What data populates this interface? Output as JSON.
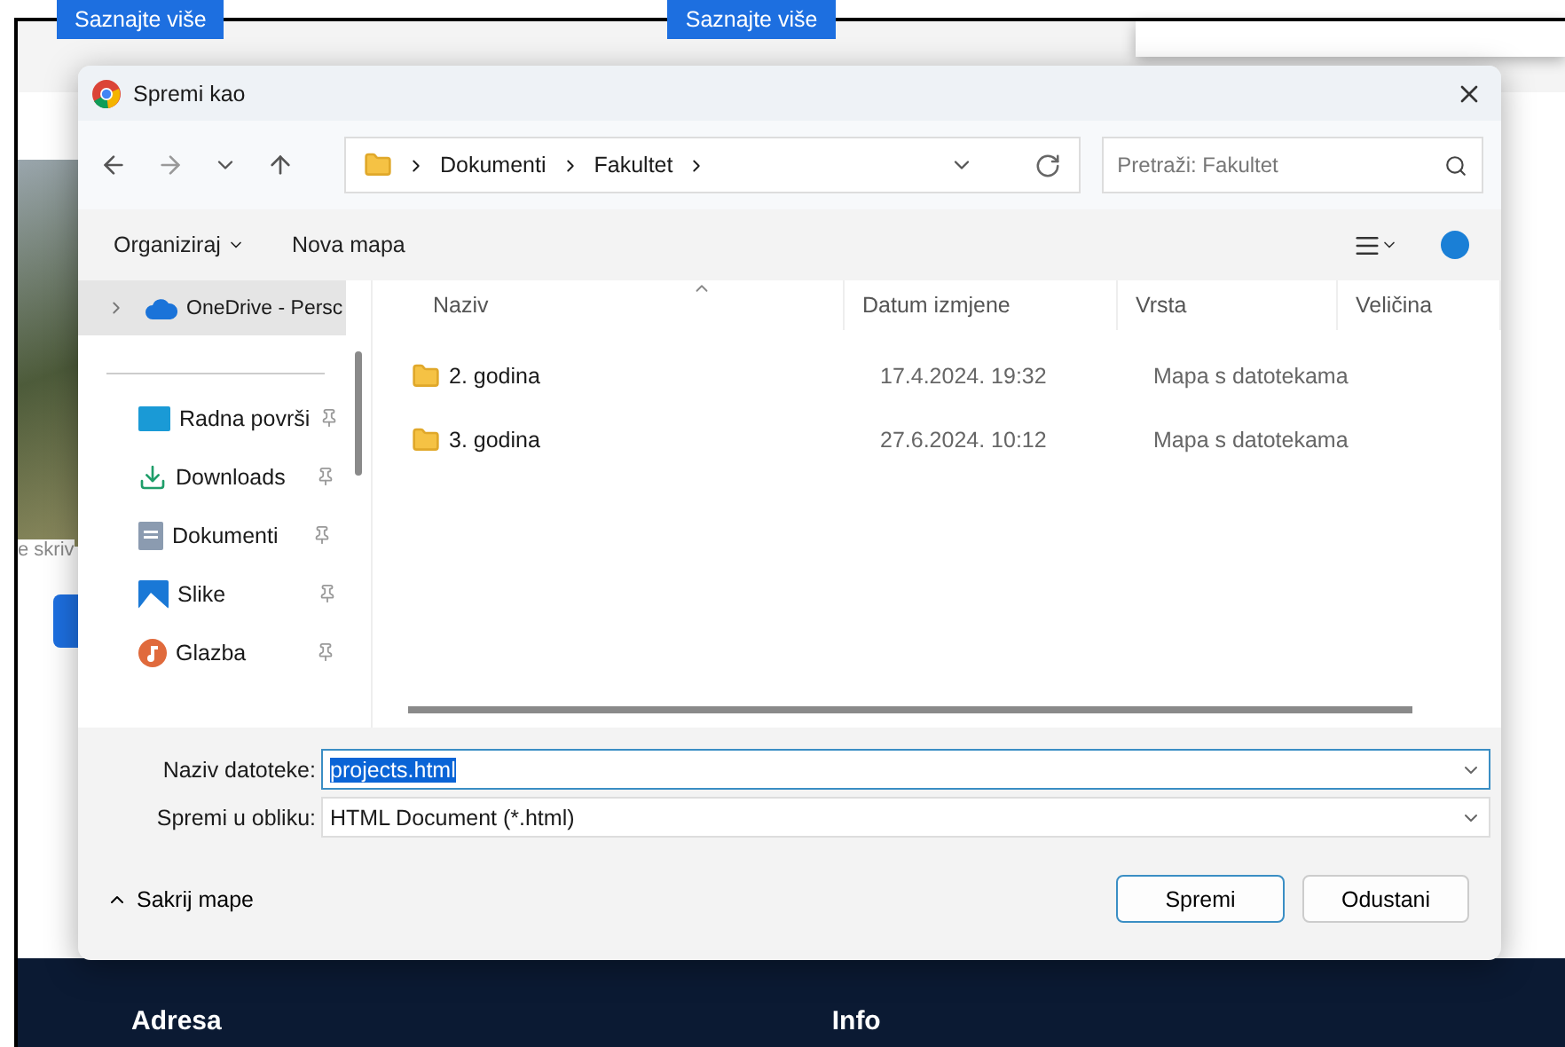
{
  "background_page": {
    "buttons": [
      "Saznajte više",
      "Saznajte više"
    ],
    "side_text": "e skriv",
    "footer_headings": [
      "Adresa",
      "Info"
    ]
  },
  "dialog": {
    "title": "Spremi kao",
    "breadcrumb": [
      "Dokumenti",
      "Fakultet"
    ],
    "search": {
      "placeholder": "Pretraži: Fakultet"
    },
    "toolbar": {
      "organize": "Organiziraj",
      "new_folder": "Nova mapa"
    },
    "sidebar": {
      "items": [
        {
          "label": "OneDrive - Persc",
          "kind": "cloud",
          "selected": true,
          "pinned": false
        },
        {
          "label": "Radna površi",
          "kind": "desktop",
          "selected": false,
          "pinned": true
        },
        {
          "label": "Downloads",
          "kind": "download",
          "selected": false,
          "pinned": true
        },
        {
          "label": "Dokumenti",
          "kind": "document",
          "selected": false,
          "pinned": true
        },
        {
          "label": "Slike",
          "kind": "pictures",
          "selected": false,
          "pinned": true
        },
        {
          "label": "Glazba",
          "kind": "music",
          "selected": false,
          "pinned": true
        }
      ]
    },
    "table": {
      "columns": [
        "Naziv",
        "Datum izmjene",
        "Vrsta",
        "Veličina"
      ],
      "rows": [
        {
          "name": "2. godina",
          "date": "17.4.2024. 19:32",
          "type": "Mapa s datotekama"
        },
        {
          "name": "3. godina",
          "date": "27.6.2024. 10:12",
          "type": "Mapa s datotekama"
        }
      ]
    },
    "file_name": {
      "label": "Naziv datoteke:",
      "value": "projects.html",
      "text_selected": true
    },
    "file_type": {
      "label": "Spremi u obliku:",
      "value": "HTML Document (*.html)"
    },
    "hide_folders": "Sakrij mape",
    "buttons": [
      {
        "label": "Spremi",
        "default": true
      },
      {
        "label": "Odustani",
        "default": false
      }
    ]
  }
}
